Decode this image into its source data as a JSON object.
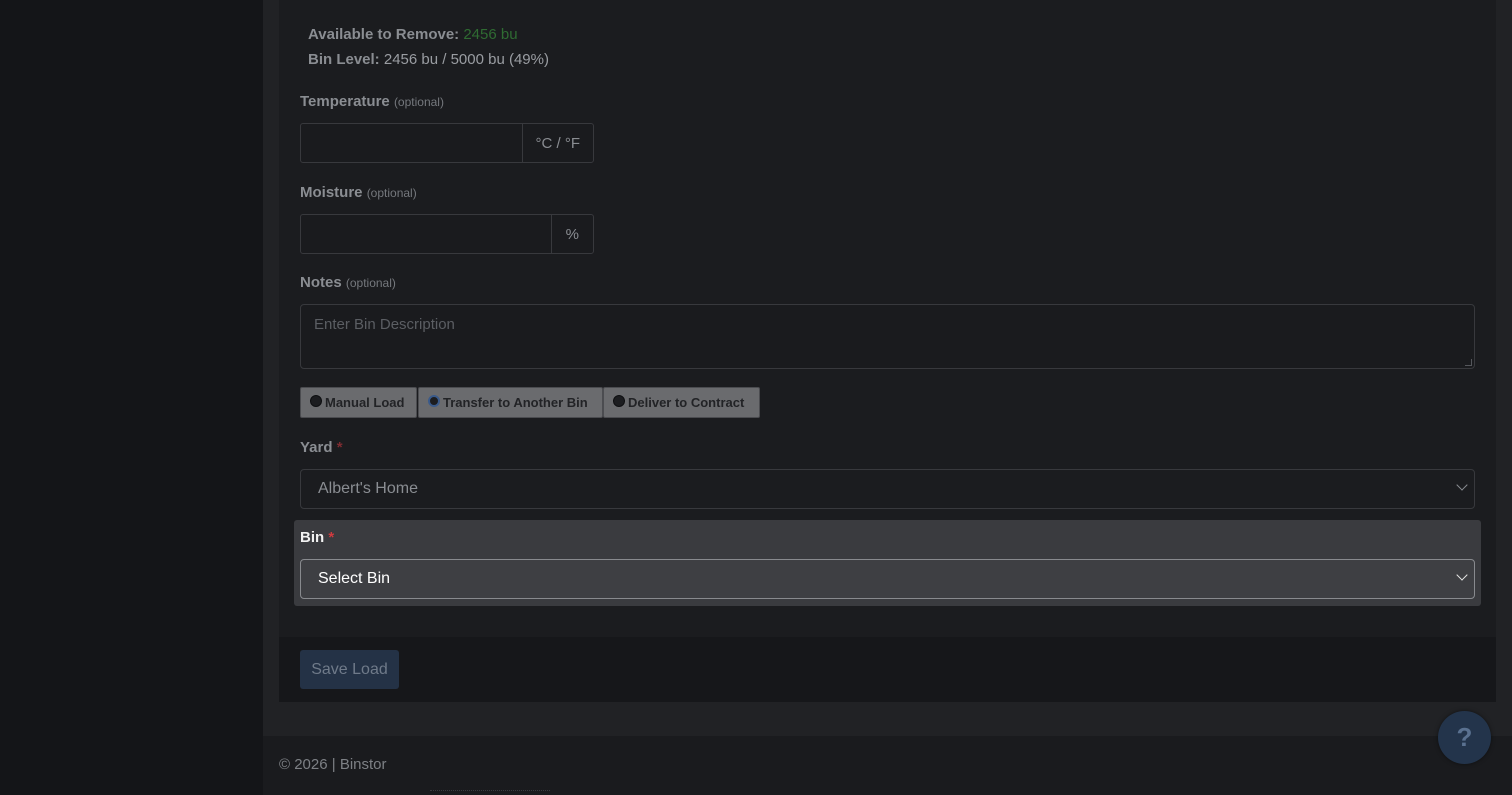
{
  "stock": {
    "available_label": "Available to Remove:",
    "available_value": "2456 bu",
    "bin_level_label": "Bin Level:",
    "bin_level_value": "2456 bu / 5000 bu (49%)"
  },
  "form": {
    "temperature_label": "Temperature",
    "temperature_optional": "(optional)",
    "temperature_unit": "°C / °F",
    "moisture_label": "Moisture",
    "moisture_optional": "(optional)",
    "moisture_unit": "%",
    "notes_label": "Notes",
    "notes_optional": "(optional)",
    "notes_placeholder": "Enter Bin Description",
    "load_types": [
      {
        "label": "Manual Load",
        "checked": false
      },
      {
        "label": "Transfer to Another Bin",
        "checked": true
      },
      {
        "label": "Deliver to Contract",
        "checked": false
      }
    ],
    "yard_label": "Yard",
    "yard_required": "*",
    "yard_value": "Albert's Home",
    "bin_label": "Bin",
    "bin_required": "*",
    "bin_value": "Select Bin",
    "save_label": "Save Load"
  },
  "footer": {
    "copyright": "© 2026 | Binstor"
  },
  "help": {
    "label": "?"
  },
  "colors": {
    "accent_green": "#2f6b32",
    "required_red": "#d03a3f",
    "primary_button": "#243246"
  }
}
